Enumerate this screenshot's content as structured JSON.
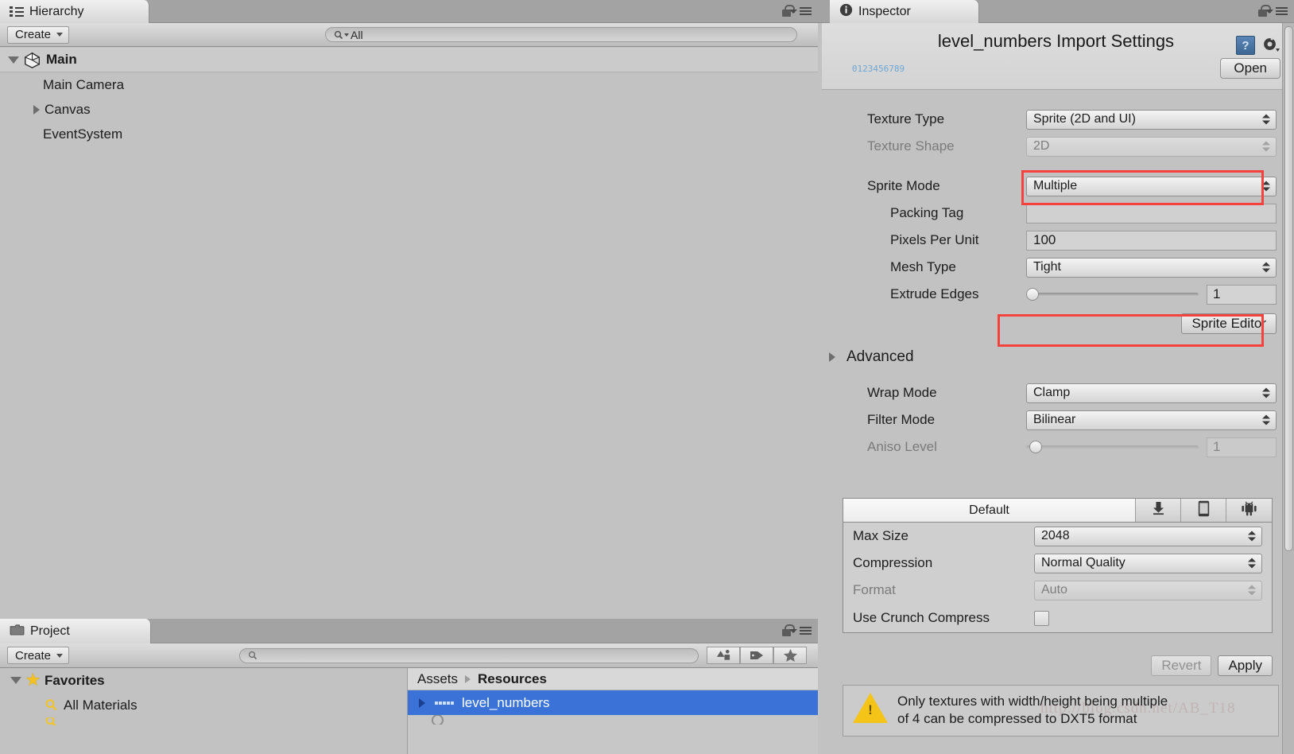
{
  "hierarchy": {
    "tab_label": "Hierarchy",
    "tab_icon": "hierarchy-icon",
    "create_label": "Create",
    "search_value": "All",
    "search_icon": "search-dropdown-icon",
    "lock_icon": "lock-icon",
    "menu_icon": "panel-menu-icon",
    "root": {
      "label": "Main",
      "icon": "unity-scene-icon"
    },
    "items": [
      {
        "label": "Main Camera",
        "expandable": false
      },
      {
        "label": "Canvas",
        "expandable": true
      },
      {
        "label": "EventSystem",
        "expandable": false
      }
    ]
  },
  "project": {
    "tab_label": "Project",
    "tab_icon": "folder-icon",
    "create_label": "Create",
    "search_value": "",
    "search_icon": "search-icon",
    "lock_icon": "lock-icon",
    "menu_icon": "panel-menu-icon",
    "toolbar_icons": [
      "new-asset-icon",
      "label-icon",
      "favorite-star-icon"
    ],
    "favorites": {
      "label": "Favorites",
      "icon": "star-icon",
      "items": [
        {
          "label": "All Materials",
          "icon": "saved-search-icon"
        }
      ]
    },
    "breadcrumb": [
      "Assets",
      "Resources"
    ],
    "assets": [
      {
        "label": "level_numbers",
        "selected": true,
        "expandable": true,
        "icon": "sprite-sheet-icon"
      }
    ]
  },
  "inspector": {
    "tab_label": "Inspector",
    "tab_icon": "info-icon",
    "lock_icon": "lock-icon",
    "menu_icon": "panel-menu-icon",
    "title": "level_numbers Import Settings",
    "thumbnail_text": "0123456789",
    "help_icon": "help-book-icon",
    "gear_icon": "gear-icon",
    "open_label": "Open",
    "fields": [
      {
        "label": "Texture Type",
        "type": "dropdown",
        "value": "Sprite (2D and UI)",
        "disabled": false,
        "indent": 0
      },
      {
        "label": "Texture Shape",
        "type": "dropdown",
        "value": "2D",
        "disabled": true,
        "indent": 0
      },
      {
        "label": "Sprite Mode",
        "type": "dropdown",
        "value": "Multiple",
        "disabled": false,
        "indent": 0,
        "highlighted": true
      },
      {
        "label": "Packing Tag",
        "type": "text",
        "value": "",
        "disabled": false,
        "indent": 1
      },
      {
        "label": "Pixels Per Unit",
        "type": "text",
        "value": "100",
        "disabled": false,
        "indent": 1
      },
      {
        "label": "Mesh Type",
        "type": "dropdown",
        "value": "Tight",
        "disabled": false,
        "indent": 1
      },
      {
        "label": "Extrude Edges",
        "type": "slider",
        "value": "1",
        "slider_pct": 0,
        "disabled": false,
        "indent": 1
      }
    ],
    "sprite_editor_label": "Sprite Editor",
    "advanced_label": "Advanced",
    "advanced_expanded": false,
    "texture_fields": [
      {
        "label": "Wrap Mode",
        "type": "dropdown",
        "value": "Clamp",
        "disabled": false
      },
      {
        "label": "Filter Mode",
        "type": "dropdown",
        "value": "Bilinear",
        "disabled": false
      },
      {
        "label": "Aniso Level",
        "type": "slider",
        "value": "1",
        "slider_pct": 2,
        "disabled": true
      }
    ],
    "platform": {
      "tabs": [
        {
          "label": "Default",
          "icon": null,
          "active": true
        },
        {
          "label": "",
          "icon": "standalone-icon",
          "active": false
        },
        {
          "label": "",
          "icon": "ios-device-icon",
          "active": false
        },
        {
          "label": "",
          "icon": "android-icon",
          "active": false
        }
      ],
      "rows": [
        {
          "label": "Max Size",
          "type": "dropdown",
          "value": "2048",
          "disabled": false
        },
        {
          "label": "Compression",
          "type": "dropdown",
          "value": "Normal Quality",
          "disabled": false
        },
        {
          "label": "Format",
          "type": "dropdown",
          "value": "Auto",
          "disabled": true
        },
        {
          "label": "Use Crunch Compress",
          "type": "checkbox",
          "value": false,
          "disabled": false
        }
      ]
    },
    "revert_label": "Revert",
    "apply_label": "Apply",
    "warning": {
      "icon": "warning-icon",
      "line1": "Only textures with width/height being multiple",
      "line2": "of 4 can be compressed to DXT5 format"
    },
    "watermark": "http://blog.csdn.net/AB_T18"
  },
  "colors": {
    "selection_blue": "#3a72d8",
    "highlight_red": "#f4433c",
    "panel_bg": "#c2c2c2",
    "warning_yellow": "#f4c518"
  }
}
